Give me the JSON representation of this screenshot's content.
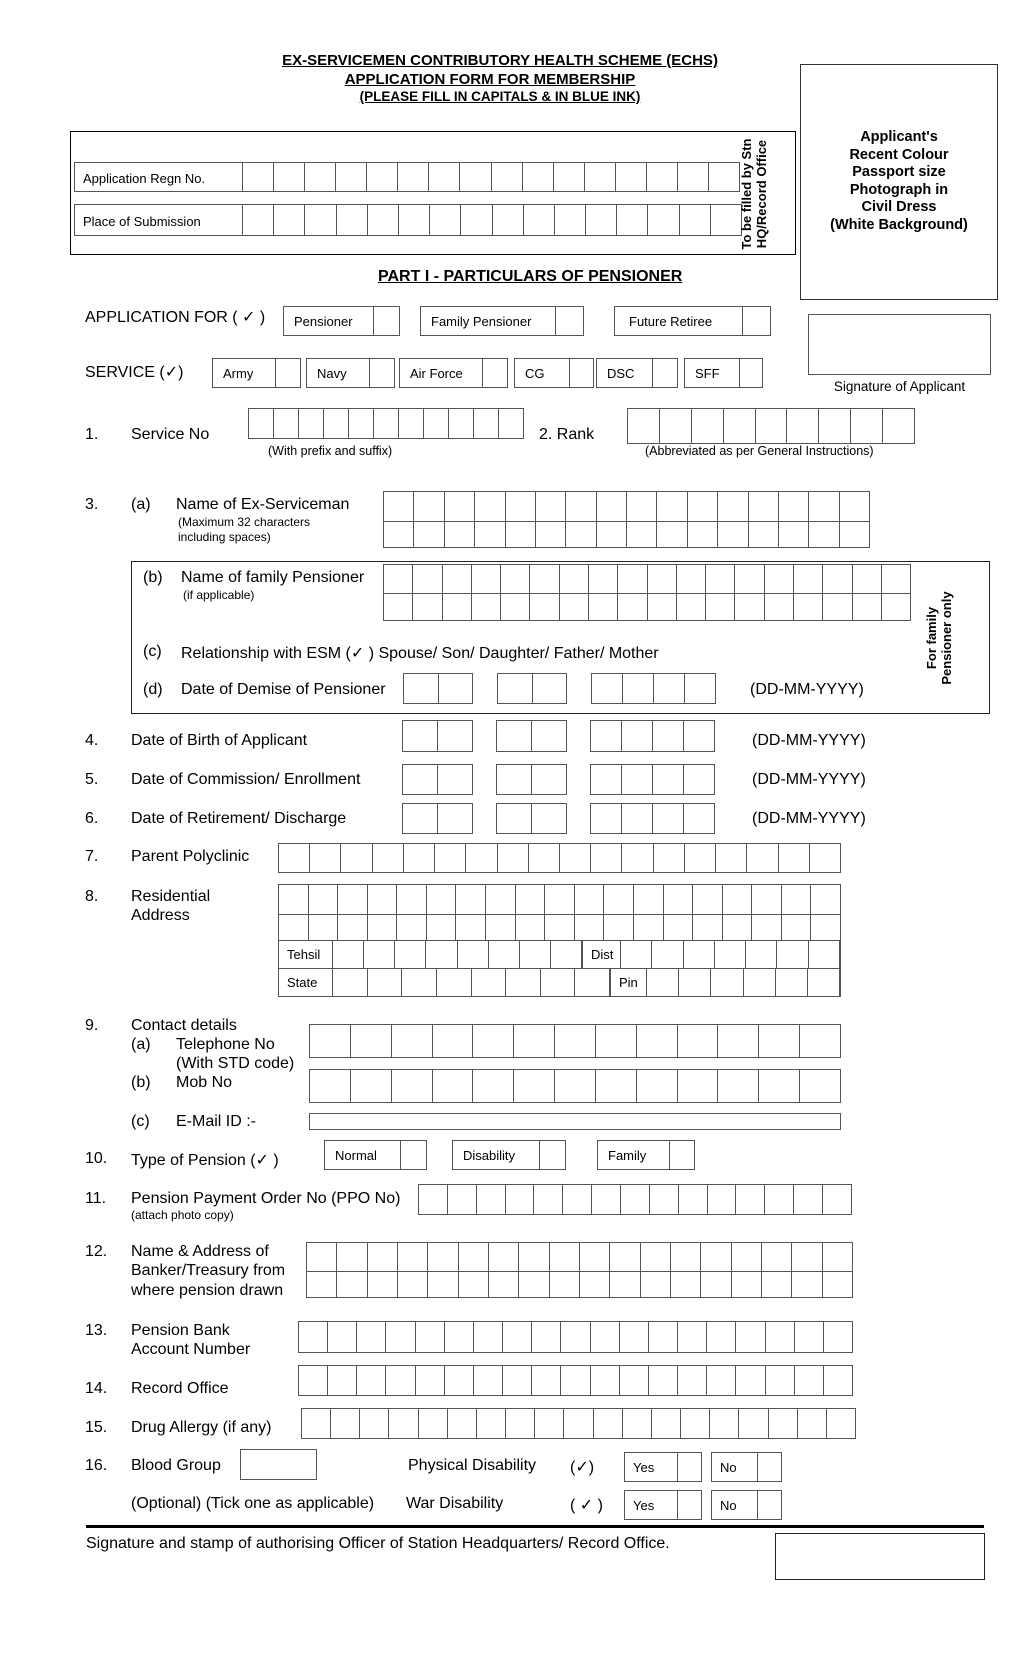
{
  "header": {
    "title_line1": "EX-SERVICEMEN CONTRIBUTORY HEALTH SCHEME (ECHS)",
    "title_line2": "APPLICATION FORM FOR MEMBERSHIP",
    "instruction": "(PLEASE FILL IN CAPITALS & IN BLUE INK)"
  },
  "office_box": {
    "regn_label": "Application Regn No.",
    "regn_value": "",
    "place_label": "Place of Submission",
    "place_value": "",
    "side_line1": "To be filled by Stn",
    "side_line2": "HQ/Record Office"
  },
  "photo": {
    "lines": [
      "Applicant's",
      "Recent Colour",
      "Passport size",
      "Photograph in",
      "Civil Dress",
      "(White Background)"
    ],
    "signature_label": "Signature of Applicant"
  },
  "part_title": "PART I - PARTICULARS OF PENSIONER",
  "application_for": {
    "label": "APPLICATION FOR ( ✓ )",
    "options": [
      "Pensioner",
      "Family Pensioner",
      "Future Retiree"
    ]
  },
  "service": {
    "label": "SERVICE (✓)",
    "options": [
      "Army",
      "Navy",
      "Air Force",
      "CG",
      "DSC",
      "SFF"
    ]
  },
  "fields": {
    "f1_num": "1.",
    "f1_label": "Service No",
    "f1_hint": "(With prefix and suffix)",
    "f2_label": "2. Rank",
    "f2_hint": "(Abbreviated as per General Instructions)",
    "f3_num": "3.",
    "f3a_sub": "(a)",
    "f3a_label": "Name of Ex-Serviceman",
    "f3a_hint1": "(Maximum 32 characters",
    "f3a_hint2": "including spaces)",
    "f3b_sub": "(b)",
    "f3b_label": "Name of family Pensioner",
    "f3b_hint": "(if applicable)",
    "f3c_sub": "(c)",
    "f3c_label": "Relationship with ESM (✓ ) Spouse/ Son/ Daughter/ Father/ Mother",
    "f3d_sub": "(d)",
    "f3d_label": "Date of Demise of Pensioner",
    "family_side1": "For family",
    "family_side2": "Pensioner only",
    "date_format": "(DD-MM-YYYY)",
    "f4_num": "4.",
    "f4_label": "Date of Birth of Applicant",
    "f5_num": "5.",
    "f5_label": "Date of Commission/ Enrollment",
    "f6_num": "6.",
    "f6_label": "Date of Retirement/ Discharge",
    "f7_num": "7.",
    "f7_label": "Parent Polyclinic",
    "f8_num": "8.",
    "f8_label1": "Residential",
    "f8_label2": "Address",
    "tehsil": "Tehsil",
    "dist": "Dist",
    "state": "State",
    "pin": "Pin",
    "f9_num": "9.",
    "f9_label": "Contact details",
    "f9a_sub": "(a)",
    "f9a_label1": "Telephone No",
    "f9a_label2": "(With STD code)",
    "f9b_sub": "(b)",
    "f9b_label": "Mob No",
    "f9c_sub": "(c)",
    "f9c_label": "E-Mail ID :-",
    "email_value": "",
    "f10_num": "10.",
    "f10_label": "Type of Pension (✓ )",
    "pension_types": [
      "Normal",
      "Disability",
      "Family"
    ],
    "f11_num": "11.",
    "f11_label": "Pension Payment Order No (PPO No)",
    "f11_hint": "(attach photo copy)",
    "f12_num": "12.",
    "f12_label1": "Name & Address of",
    "f12_label2": "Banker/Treasury from",
    "f12_label3": "where pension drawn",
    "f13_num": "13.",
    "f13_label1": "Pension Bank",
    "f13_label2": "Account Number",
    "f14_num": "14.",
    "f14_label": "Record Office",
    "f15_num": "15.",
    "f15_label": "Drug Allergy (if any)",
    "f16_num": "16.",
    "f16_label": "Blood Group",
    "blood_group_value": "",
    "f16_optional": "(Optional) (Tick one as applicable)",
    "physical_disability": "Physical Disability",
    "war_disability": "War Disability",
    "tick": "(✓)",
    "tick2": "( ✓ )",
    "yes": "Yes",
    "no": "No"
  },
  "footer": {
    "auth_label": "Signature and stamp of authorising Officer of Station Headquarters/ Record Office."
  }
}
